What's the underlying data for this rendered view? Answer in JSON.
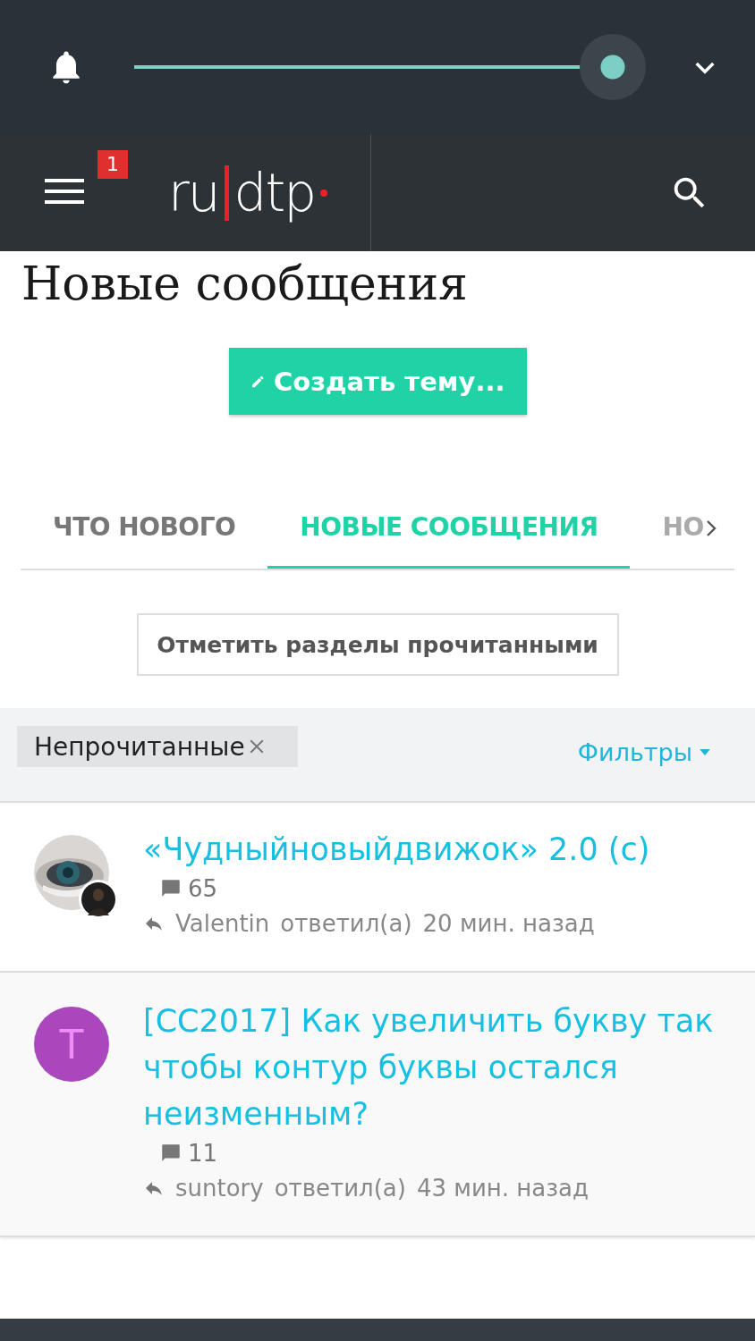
{
  "top_bar": {
    "volume": {
      "level": 1.0
    }
  },
  "header": {
    "notification_count": "1",
    "logo_parts": [
      "ru",
      "dtp"
    ]
  },
  "page_title": "Новые сообщения",
  "create_button": "Создать тему...",
  "tabs": [
    {
      "label": "ЧТО НОВОГО",
      "selected": false
    },
    {
      "label": "НОВЫЕ СООБЩЕНИЯ",
      "selected": true
    },
    {
      "label": "НО",
      "selected": false
    }
  ],
  "mark_read_button": "Отметить разделы прочитанными",
  "filter_bar": {
    "active_filter": "Непрочитанные",
    "filters_link": "Фильтры"
  },
  "threads": [
    {
      "title": "«Чудныйновыйдвижок» 2.0 (c)",
      "replies": "65",
      "user": "Valentin",
      "action": "ответил(а)",
      "time": "20 мин. назад"
    },
    {
      "title": "[CC2017] Как увеличить букву так чтобы контур буквы остался неизменным?",
      "replies": "11",
      "user": "suntory",
      "action": "ответил(а)",
      "time": "43 мин. назад",
      "avatar": {
        "kind": "letter",
        "letter": "T",
        "color": "#ab47bc"
      }
    }
  ]
}
